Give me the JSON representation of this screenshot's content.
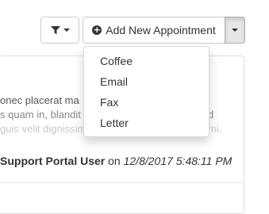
{
  "toolbar": {
    "filter_icon": "filter-icon",
    "add_icon": "plus-circle-icon",
    "add_label": "Add New Appointment"
  },
  "dropdown": {
    "items": [
      {
        "label": "Coffee"
      },
      {
        "label": "Email"
      },
      {
        "label": "Fax"
      },
      {
        "label": "Letter"
      }
    ]
  },
  "timeline": {
    "note_preview_lines": [
      "onec placerat ma",
      "s quam in, blandit",
      "guis velit dignissim"
    ],
    "note_preview_right": [
      "d",
      "mi."
    ],
    "author": "Support Portal User",
    "on_word": "on",
    "timestamp": "12/8/2017 5:48:11 PM"
  },
  "colors": {
    "text": "#333333",
    "border": "#cccccc",
    "active_button": "#e6e6e6"
  }
}
